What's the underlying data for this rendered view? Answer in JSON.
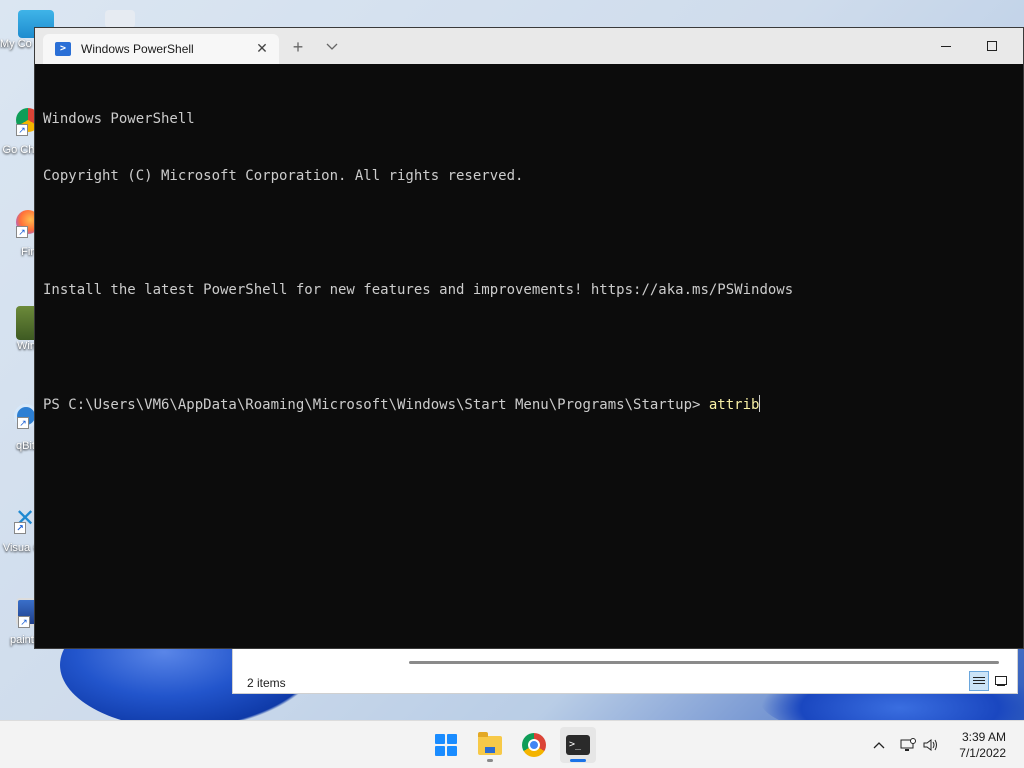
{
  "desktop": {
    "icons": [
      {
        "name": "my-computer",
        "label": "My Co"
      },
      {
        "name": "google-chrome",
        "label": "Go Chr"
      },
      {
        "name": "firefox",
        "label": "Fir"
      },
      {
        "name": "windows",
        "label": "Win"
      },
      {
        "name": "qbittorrent",
        "label": "qBitt"
      },
      {
        "name": "visual-studio-code",
        "label": "Visua C"
      },
      {
        "name": "paint-net",
        "label": "paint.net"
      }
    ]
  },
  "terminal": {
    "tab_title": "Windows PowerShell",
    "tab_icon": "powershell-icon",
    "new_tab_label": "+",
    "dropdown_label": "⌄",
    "close_tab_label": "✕",
    "lines": [
      "Windows PowerShell",
      "Copyright (C) Microsoft Corporation. All rights reserved.",
      "",
      "Install the latest PowerShell for new features and improvements! https://aka.ms/PSWindows",
      ""
    ],
    "prompt": "PS C:\\Users\\VM6\\AppData\\Roaming\\Microsoft\\Windows\\Start Menu\\Programs\\Startup> ",
    "command": "attrib"
  },
  "explorer": {
    "status": "2 items"
  },
  "taskbar": {
    "apps": [
      "start-icon",
      "file-explorer-icon",
      "chrome-icon",
      "terminal-icon"
    ],
    "tray": [
      "chevron-up-icon",
      "network-icon",
      "volume-icon"
    ],
    "time": "3:39 AM",
    "date": "7/1/2022"
  },
  "colors": {
    "console_bg": "#0c0c0c",
    "console_text": "#cccccc",
    "command_text": "#f9f1a5",
    "accent": "#1a73e8"
  }
}
